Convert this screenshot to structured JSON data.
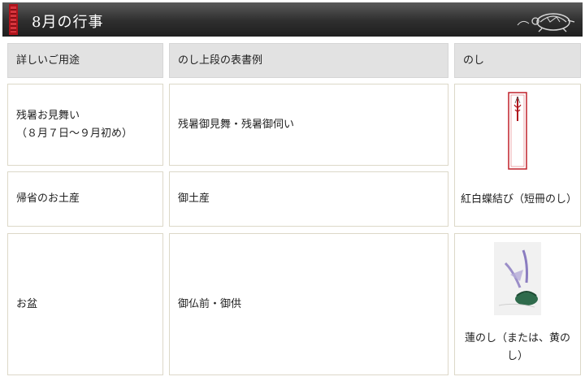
{
  "header": {
    "title": "8月の行事",
    "seal_icon": "red-hanko-seal",
    "turtle_icon": "turtle-logo"
  },
  "table": {
    "columns": [
      "詳しいご用途",
      "のし上段の表書例",
      "のし"
    ],
    "rows": [
      {
        "use": "残暑お見舞い\n（８月７日～９月初め）",
        "inscription": "残暑御見舞・残暑御伺い"
      },
      {
        "use": "帰省のお土産",
        "inscription": "御土産"
      },
      {
        "use": "お盆",
        "inscription": "御仏前・御供"
      }
    ],
    "noshi": [
      {
        "label": "紅白蝶結び（短冊のし）",
        "image": "tanzaku-noshi-red-white-bow"
      },
      {
        "label": "蓮のし（または、黄のし）",
        "image": "lotus-noshi"
      }
    ]
  },
  "colors": {
    "header_dark": "#2e2e2e",
    "seal_red": "#b0141c",
    "header_cell_bg": "#e2e2e2",
    "cell_border": "#dcd8c8"
  }
}
